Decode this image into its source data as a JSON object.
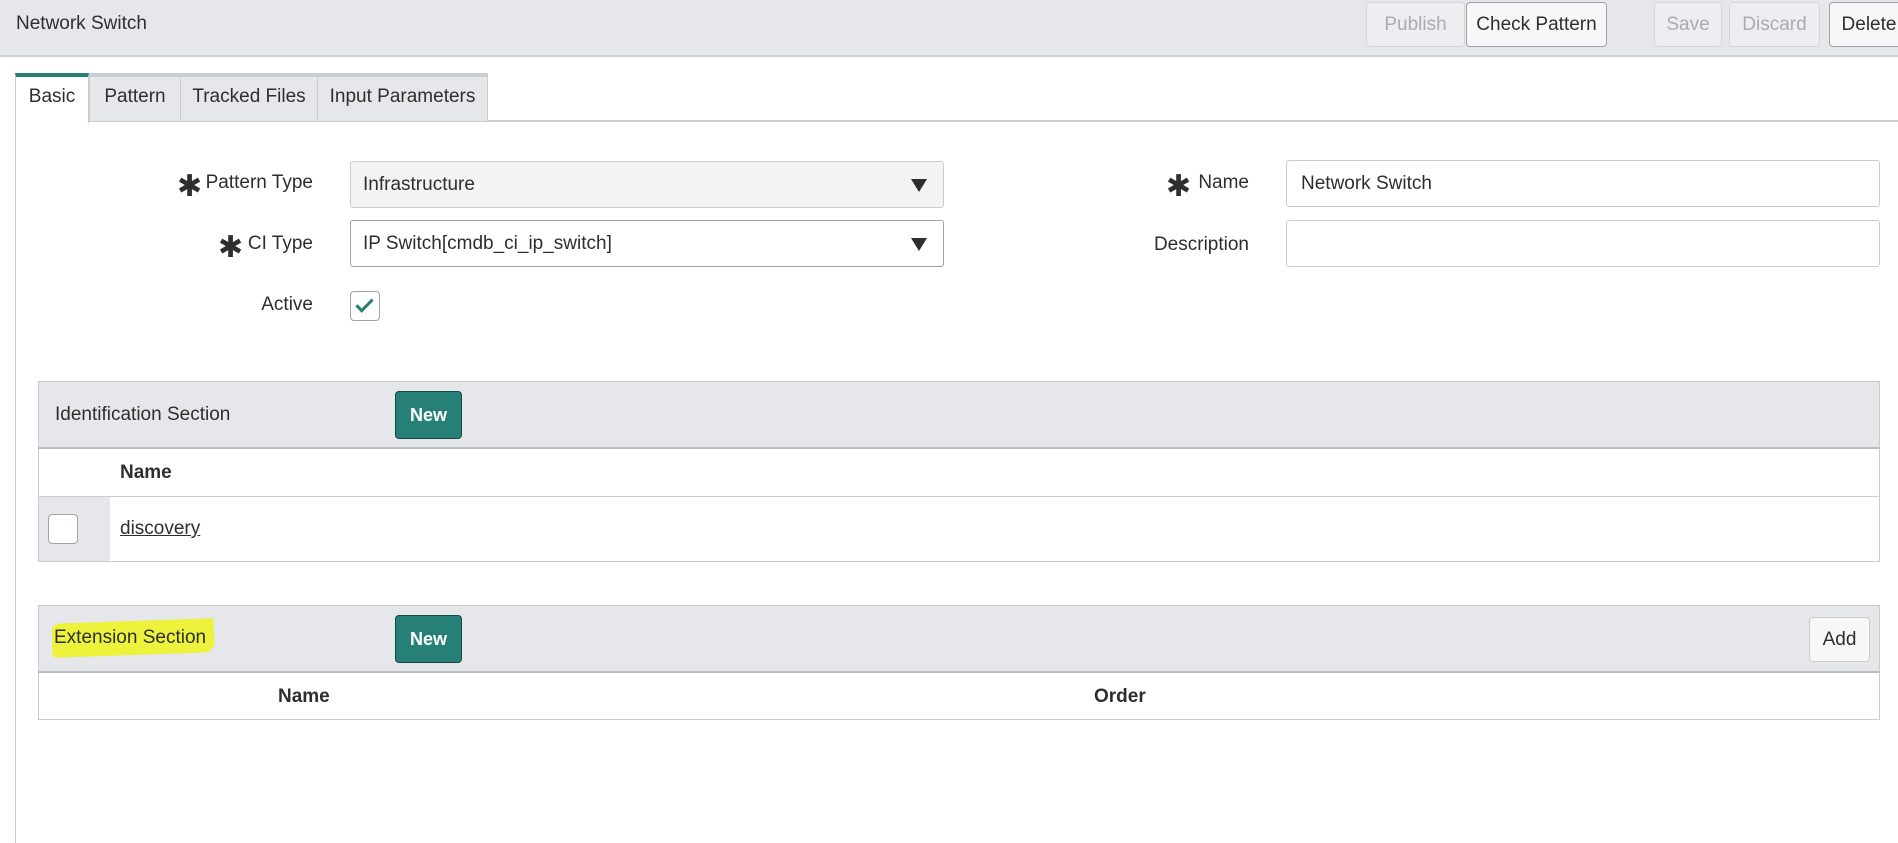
{
  "header": {
    "title": "Network Switch",
    "buttons": {
      "publish": "Publish",
      "check_pattern": "Check Pattern",
      "save": "Save",
      "discard": "Discard",
      "delete": "Delete"
    }
  },
  "tabs": [
    {
      "label": "Basic",
      "selected": true
    },
    {
      "label": "Pattern",
      "selected": false
    },
    {
      "label": "Tracked Files",
      "selected": false
    },
    {
      "label": "Input Parameters",
      "selected": false
    }
  ],
  "form": {
    "pattern_type": {
      "label": "Pattern Type",
      "value": "Infrastructure",
      "required": true
    },
    "ci_type": {
      "label": "CI Type",
      "value": "IP Switch[cmdb_ci_ip_switch]",
      "required": true
    },
    "active": {
      "label": "Active",
      "checked": true
    },
    "name": {
      "label": "Name",
      "value": "Network Switch",
      "required": true
    },
    "description": {
      "label": "Description",
      "value": ""
    }
  },
  "identification_section": {
    "title": "Identification Section",
    "new_label": "New",
    "columns": [
      "Name"
    ],
    "rows": [
      {
        "name": "discovery"
      }
    ]
  },
  "extension_section": {
    "title": "Extension Section",
    "new_label": "New",
    "add_label": "Add",
    "columns": [
      "Name",
      "Order"
    ]
  },
  "colors": {
    "accent": "#278076",
    "header_bg": "#e5e7ea",
    "highlight": "#edf23a"
  }
}
